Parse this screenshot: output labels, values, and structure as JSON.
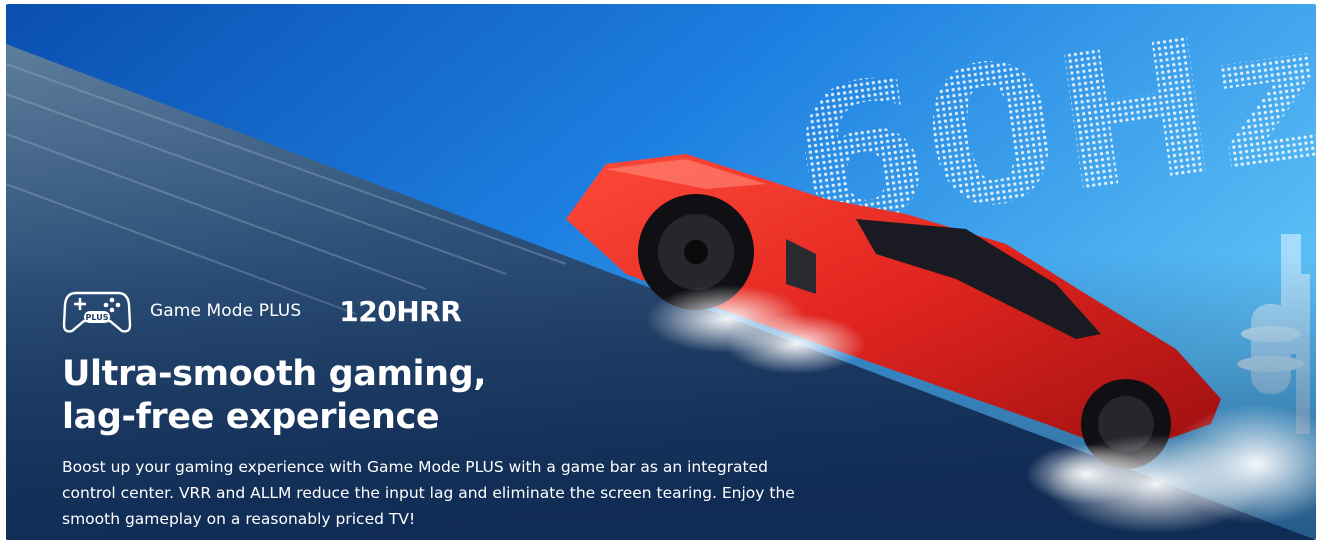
{
  "banner": {
    "feature_label": "Game Mode PLUS",
    "feature_icon": "gamepad-plus-icon",
    "icon_badge": "PLUS",
    "hrr_label": "120HRR",
    "headline_line1": "Ultra-smooth gaming,",
    "headline_line2": "lag-free experience",
    "description": "Boost up your gaming experience with Game Mode PLUS with a game bar as an integrated control center. VRR and ALLM reduce the input lag and eliminate the screen tearing. Enjoy the smooth gameplay on a reasonably priced TV!",
    "backdrop_text": "60Hz",
    "colors": {
      "sky": "#1f7fd8",
      "road": "#1d3d66",
      "car": "#e0241e",
      "text": "#ffffff"
    }
  }
}
